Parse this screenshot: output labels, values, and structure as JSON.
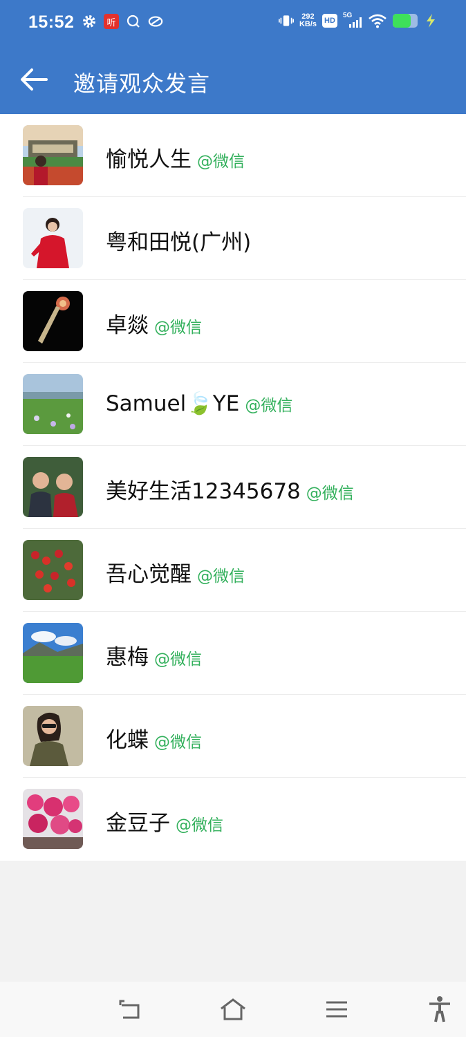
{
  "status_bar": {
    "time": "15:52",
    "net_speed_value": "292",
    "net_speed_unit": "KB/s",
    "hd_label": "HD",
    "signal_label": "5G",
    "ting_label": "听",
    "battery_level": 0.72
  },
  "app_bar": {
    "title": "邀请观众发言",
    "back_icon": "arrow-left-icon"
  },
  "viewers": [
    {
      "name": "愉悦人生",
      "source": "@微信"
    },
    {
      "name": "粤和田悦(广州)",
      "source": ""
    },
    {
      "name": "卓燚",
      "source": "@微信"
    },
    {
      "name": "Samuel🍃YE",
      "source": "@微信"
    },
    {
      "name": "美好生活12345678",
      "source": "@微信"
    },
    {
      "name": "吾心觉醒",
      "source": "@微信"
    },
    {
      "name": "惠梅",
      "source": "@微信"
    },
    {
      "name": "化蝶",
      "source": "@微信"
    },
    {
      "name": "金豆子",
      "source": "@微信"
    }
  ],
  "nav_bar": {
    "icons": [
      "back-icon",
      "home-icon",
      "menu-icon",
      "accessibility-icon"
    ]
  },
  "colors": {
    "header": "#3d79c9",
    "source_green": "#33b05c",
    "text": "#111111"
  }
}
